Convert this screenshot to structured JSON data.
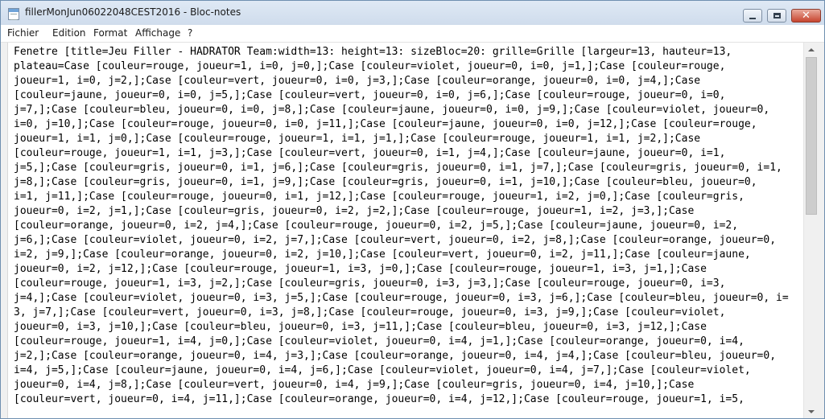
{
  "window": {
    "title": "fillerMonJun06022048CEST2016 - Bloc-notes",
    "icon": "notepad-icon",
    "controls": {
      "minimize": "minimize-icon",
      "maximize": "maximize-icon",
      "close": "close-icon",
      "close_glyph": "✕"
    }
  },
  "menu": {
    "items": [
      "Fichier",
      "Edition",
      "Format",
      "Affichage",
      "?"
    ]
  },
  "document": {
    "lines": [
      "Fenetre [title=Jeu Filler - HADRATOR Team:width=13: height=13: sizeBloc=20: grille=Grille [largeur=13, hauteur=13,",
      "plateau=Case [couleur=rouge, joueur=1, i=0, j=0,];Case [couleur=violet, joueur=0, i=0, j=1,];Case [couleur=rouge,",
      "joueur=1, i=0, j=2,];Case [couleur=vert, joueur=0, i=0, j=3,];Case [couleur=orange, joueur=0, i=0, j=4,];Case",
      "[couleur=jaune, joueur=0, i=0, j=5,];Case [couleur=vert, joueur=0, i=0, j=6,];Case [couleur=rouge, joueur=0, i=0,",
      "j=7,];Case [couleur=bleu, joueur=0, i=0, j=8,];Case [couleur=jaune, joueur=0, i=0, j=9,];Case [couleur=violet, joueur=0,",
      "i=0, j=10,];Case [couleur=rouge, joueur=0, i=0, j=11,];Case [couleur=jaune, joueur=0, i=0, j=12,];Case [couleur=rouge,",
      "joueur=1, i=1, j=0,];Case [couleur=rouge, joueur=1, i=1, j=1,];Case [couleur=rouge, joueur=1, i=1, j=2,];Case",
      "[couleur=rouge, joueur=1, i=1, j=3,];Case [couleur=vert, joueur=0, i=1, j=4,];Case [couleur=jaune, joueur=0, i=1,",
      "j=5,];Case [couleur=gris, joueur=0, i=1, j=6,];Case [couleur=gris, joueur=0, i=1, j=7,];Case [couleur=gris, joueur=0, i=1,",
      "j=8,];Case [couleur=gris, joueur=0, i=1, j=9,];Case [couleur=gris, joueur=0, i=1, j=10,];Case [couleur=bleu, joueur=0,",
      "i=1, j=11,];Case [couleur=rouge, joueur=0, i=1, j=12,];Case [couleur=rouge, joueur=1, i=2, j=0,];Case [couleur=gris,",
      "joueur=0, i=2, j=1,];Case [couleur=gris, joueur=0, i=2, j=2,];Case [couleur=rouge, joueur=1, i=2, j=3,];Case",
      "[couleur=orange, joueur=0, i=2, j=4,];Case [couleur=rouge, joueur=0, i=2, j=5,];Case [couleur=jaune, joueur=0, i=2,",
      "j=6,];Case [couleur=violet, joueur=0, i=2, j=7,];Case [couleur=vert, joueur=0, i=2, j=8,];Case [couleur=orange, joueur=0,",
      "i=2, j=9,];Case [couleur=orange, joueur=0, i=2, j=10,];Case [couleur=vert, joueur=0, i=2, j=11,];Case [couleur=jaune,",
      "joueur=0, i=2, j=12,];Case [couleur=rouge, joueur=1, i=3, j=0,];Case [couleur=rouge, joueur=1, i=3, j=1,];Case",
      "[couleur=rouge, joueur=1, i=3, j=2,];Case [couleur=gris, joueur=0, i=3, j=3,];Case [couleur=rouge, joueur=0, i=3,",
      "j=4,];Case [couleur=violet, joueur=0, i=3, j=5,];Case [couleur=rouge, joueur=0, i=3, j=6,];Case [couleur=bleu, joueur=0, i=",
      "3, j=7,];Case [couleur=vert, joueur=0, i=3, j=8,];Case [couleur=rouge, joueur=0, i=3, j=9,];Case [couleur=violet,",
      "joueur=0, i=3, j=10,];Case [couleur=bleu, joueur=0, i=3, j=11,];Case [couleur=bleu, joueur=0, i=3, j=12,];Case",
      "[couleur=rouge, joueur=1, i=4, j=0,];Case [couleur=violet, joueur=0, i=4, j=1,];Case [couleur=orange, joueur=0, i=4,",
      "j=2,];Case [couleur=orange, joueur=0, i=4, j=3,];Case [couleur=orange, joueur=0, i=4, j=4,];Case [couleur=bleu, joueur=0,",
      "i=4, j=5,];Case [couleur=jaune, joueur=0, i=4, j=6,];Case [couleur=violet, joueur=0, i=4, j=7,];Case [couleur=violet,",
      "joueur=0, i=4, j=8,];Case [couleur=vert, joueur=0, i=4, j=9,];Case [couleur=gris, joueur=0, i=4, j=10,];Case",
      "[couleur=vert, joueur=0, i=4, j=11,];Case [couleur=orange, joueur=0, i=4, j=12,];Case [couleur=rouge, joueur=1, i=5,"
    ]
  },
  "scrollbar": {
    "up_icon": "scroll-up-icon",
    "down_icon": "scroll-down-icon"
  }
}
